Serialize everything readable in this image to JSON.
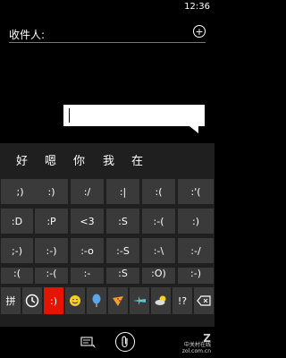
{
  "status_bar": {
    "time": "12:36"
  },
  "compose": {
    "recipient_label": "收件人:",
    "add_symbol": "+"
  },
  "keyboard": {
    "candidates": [
      "好",
      "嗯",
      "你",
      "我",
      "在"
    ],
    "emoticon_rows": [
      [
        ";)",
        ":)",
        ":/",
        ":|",
        ":(",
        ":'("
      ],
      [
        ":D",
        ":P",
        "<3",
        ":S",
        ":-(",
        ":)"
      ],
      [
        ";-)",
        ":-)",
        ":-o",
        ":-S",
        ":-\\",
        ":-/"
      ],
      [
        ":(",
        ":-(",
        ":-",
        ":S",
        ":O)",
        ":-)"
      ]
    ],
    "bottom_row": {
      "mode_label": "拼",
      "emoticon_label": ":)",
      "more_label": "!?"
    }
  },
  "watermark": {
    "brand": "Z",
    "line1": "中关村在线",
    "line2": "zol.com.cn"
  }
}
